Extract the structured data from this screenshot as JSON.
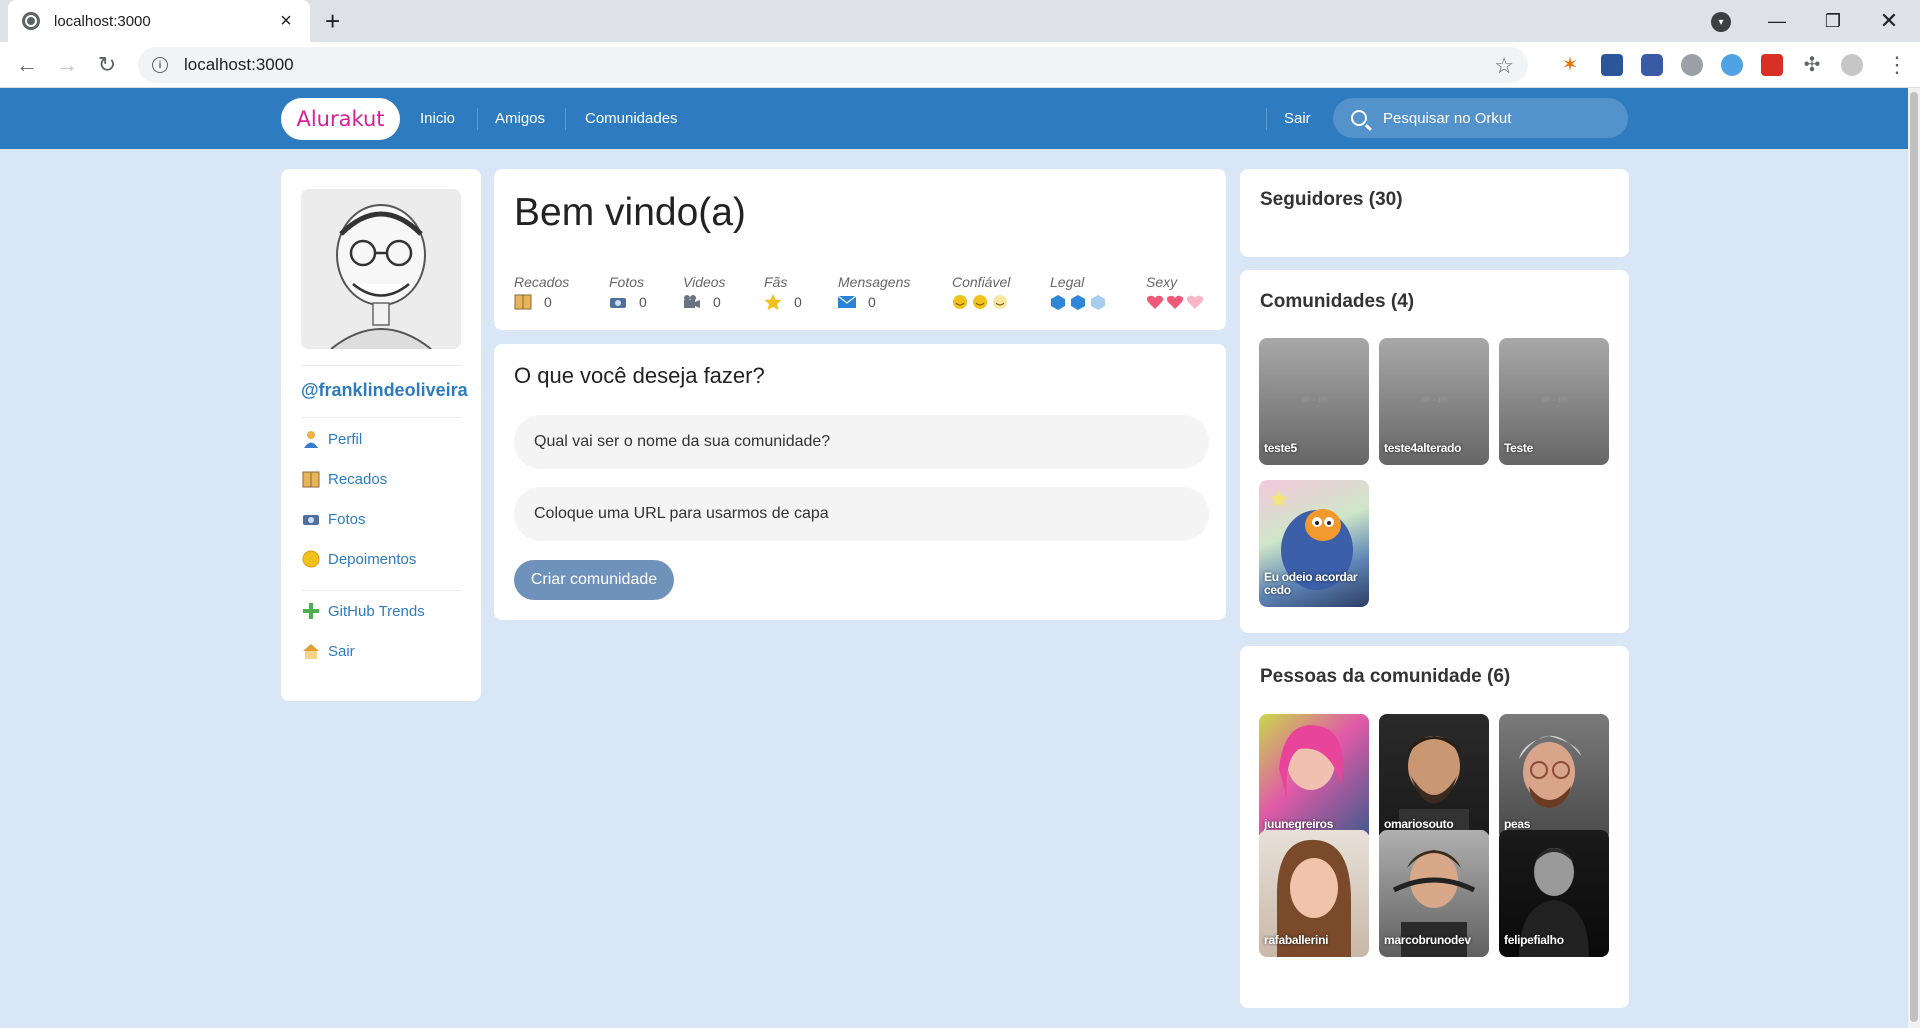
{
  "browser": {
    "tab_title": "localhost:3000",
    "url": "localhost:3000"
  },
  "header": {
    "logo": "Alurakut",
    "nav": [
      "Inicio",
      "Amigos",
      "Comunidades"
    ],
    "logout": "Sair",
    "search_placeholder": "Pesquisar no Orkut"
  },
  "profile": {
    "username": "@franklindeoliveira",
    "menu": [
      {
        "label": "Perfil",
        "icon": "user-icon"
      },
      {
        "label": "Recados",
        "icon": "book-icon"
      },
      {
        "label": "Fotos",
        "icon": "camera-icon"
      },
      {
        "label": "Depoimentos",
        "icon": "sun-icon"
      },
      {
        "label": "GitHub Trends",
        "icon": "plus-icon"
      },
      {
        "label": "Sair",
        "icon": "house-icon"
      }
    ]
  },
  "welcome": {
    "title": "Bem vindo(a)",
    "stats": [
      {
        "label": "Recados",
        "value": "0",
        "icon": "book-icon"
      },
      {
        "label": "Fotos",
        "value": "0",
        "icon": "camera-icon"
      },
      {
        "label": "Videos",
        "value": "0",
        "icon": "video-camera-icon"
      },
      {
        "label": "Fãs",
        "value": "0",
        "icon": "star-icon"
      },
      {
        "label": "Mensagens",
        "value": "0",
        "icon": "envelope-icon"
      },
      {
        "label": "Confiável",
        "icon": "smiley-icon",
        "level": 2,
        "max": 3
      },
      {
        "label": "Legal",
        "icon": "cube-icon",
        "level": 2,
        "max": 3
      },
      {
        "label": "Sexy",
        "icon": "heart-icon",
        "level": 2,
        "max": 3
      }
    ]
  },
  "form": {
    "title": "O que você deseja fazer?",
    "name_placeholder": "Qual vai ser o nome da sua comunidade?",
    "image_placeholder": "Coloque uma URL para usarmos de capa",
    "submit": "Criar comunidade"
  },
  "followers": {
    "title": "Seguidores (30)"
  },
  "communities": {
    "title": "Comunidades (4)",
    "placeholder_text": "300 × 300",
    "items": [
      "teste5",
      "teste4alterado",
      "Teste",
      "Eu odeio acordar cedo"
    ]
  },
  "people": {
    "title": "Pessoas da comunidade (6)",
    "items": [
      "juunegreiros",
      "omariosouto",
      "peas",
      "rafaballerini",
      "marcobrunodev",
      "felipefialho"
    ]
  },
  "colors": {
    "header_bg": "#2e7bbf",
    "page_bg": "#d9e6f6",
    "link": "#2e7bbf",
    "logo": "#d81d99"
  }
}
